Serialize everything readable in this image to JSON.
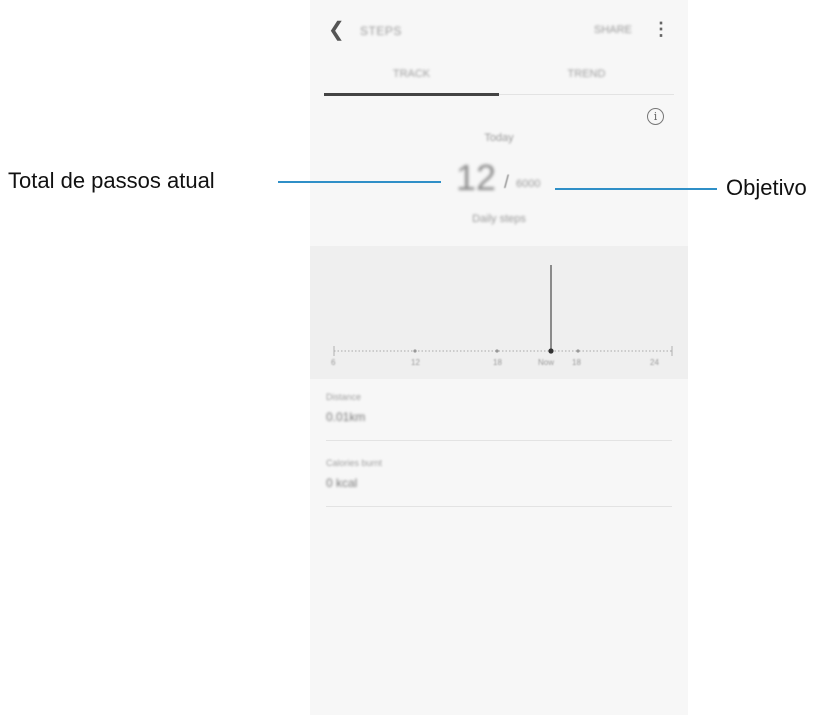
{
  "appbar": {
    "title": "STEPS",
    "share_label": "SHARE"
  },
  "tabs": [
    {
      "label": "TRACK"
    },
    {
      "label": "TREND"
    }
  ],
  "summary": {
    "day_label": "Today",
    "steps_value": "12",
    "separator": "/",
    "target": "6000",
    "caption": "Daily steps"
  },
  "chart": {
    "axis_labels": [
      "6",
      "12",
      "18",
      "Now",
      "18",
      "24"
    ]
  },
  "stats": [
    {
      "label": "Distance",
      "value": "0.01km"
    },
    {
      "label": "Calories burnt",
      "value": "0 kcal"
    }
  ],
  "annotations": {
    "left": "Total de passos atual",
    "right": "Objetivo"
  },
  "colors": {
    "leader_line": "#2f8fc7"
  }
}
